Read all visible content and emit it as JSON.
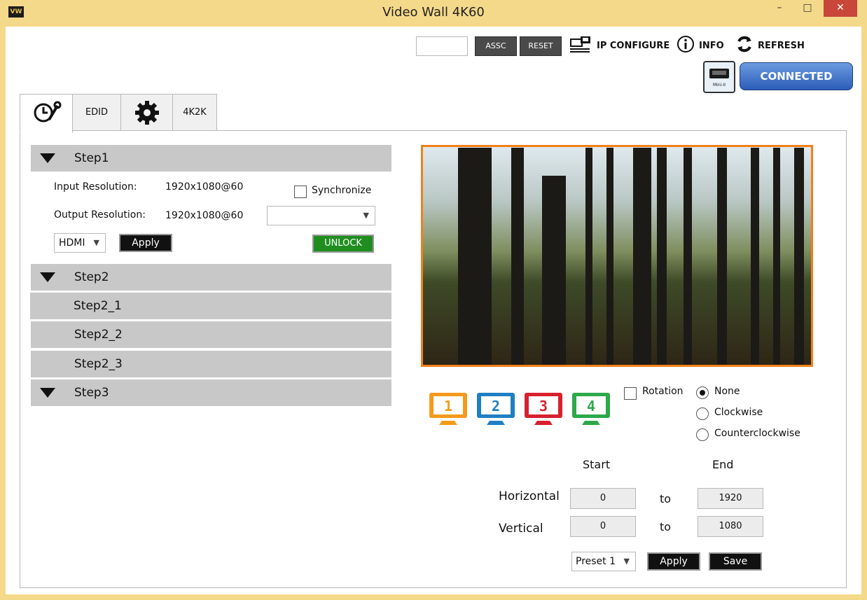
{
  "window": {
    "title": "Video Wall 4K60",
    "app_icon": "VW",
    "minimize": "–",
    "maximize": "□",
    "close": "✕"
  },
  "toolbar": {
    "assc_value": "",
    "assc_label": "ASSC",
    "reset_label": "RESET",
    "ip_configure_label": "IP CONFIGURE",
    "info_label": "INFO",
    "refresh_label": "REFRESH",
    "mini_label": "Mini-II",
    "connected_label": "CONNECTED"
  },
  "tabs": [
    {
      "label": "",
      "icon": "tools-icon"
    },
    {
      "label": "EDID"
    },
    {
      "label": "",
      "icon": "gear-icon"
    },
    {
      "label": "4K2K"
    }
  ],
  "step1": {
    "label": "Step1",
    "input_resolution_label": "Input Resolution:",
    "input_resolution_value": "1920x1080@60",
    "output_resolution_label": "Output Resolution:",
    "output_resolution_value": "1920x1080@60",
    "synchronize_label": "Synchronize",
    "output_select_value": "",
    "source_select": "HDMI",
    "apply_label": "Apply",
    "unlock_label": "UNLOCK"
  },
  "steps": {
    "step2": "Step2",
    "step2_1": "Step2_1",
    "step2_2": "Step2_2",
    "step2_3": "Step2_3",
    "step3": "Step3"
  },
  "monitors": [
    {
      "number": "1",
      "color": "#f39a1c"
    },
    {
      "number": "2",
      "color": "#1f7fc4"
    },
    {
      "number": "3",
      "color": "#d8202e"
    },
    {
      "number": "4",
      "color": "#2da84a"
    }
  ],
  "rotation": {
    "label": "Rotation",
    "checked": false,
    "options": [
      "None",
      "Clockwise",
      "Counterclockwise"
    ],
    "selected": "None"
  },
  "range": {
    "start_header": "Start",
    "end_header": "End",
    "horizontal_label": "Horizontal",
    "vertical_label": "Vertical",
    "to_label": "to",
    "h_start": "0",
    "h_end": "1920",
    "v_start": "0",
    "v_end": "1080"
  },
  "preset": {
    "value": "Preset 1",
    "apply_label": "Apply",
    "save_label": "Save"
  },
  "colors": {
    "preview_border": "#f0801a",
    "connected": "#2b5cb8",
    "unlock": "#1f8e1f",
    "step_bar": "#c8c8c8"
  }
}
